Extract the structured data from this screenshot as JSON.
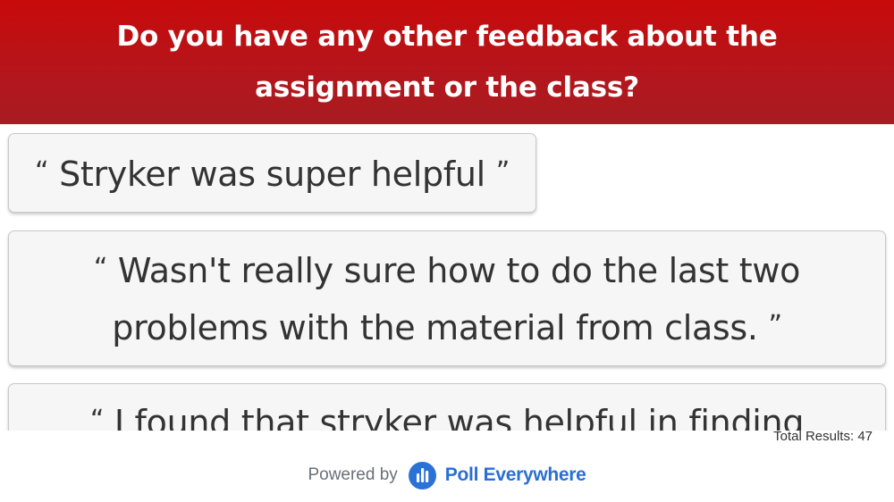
{
  "header": {
    "question": "Do you have any other feedback about the assignment or the class?"
  },
  "quote_marks": {
    "open": "“",
    "close": "”"
  },
  "responses": [
    {
      "text": "Stryker was super helpful"
    },
    {
      "text": "Wasn't really sure how to do the last two problems with the material from class."
    },
    {
      "text": "I found that stryker was helpful in finding edge"
    }
  ],
  "results": {
    "total_label": "Total Results: 47"
  },
  "footer": {
    "powered_by": "Powered by",
    "brand": "Poll Everywhere",
    "brand_color": "#2b6fd3",
    "logo_icon": "poll-everywhere-logo-icon"
  },
  "colors": {
    "header_red": "#c80a0a",
    "card_bg": "#f6f6f6",
    "text": "#333333"
  }
}
